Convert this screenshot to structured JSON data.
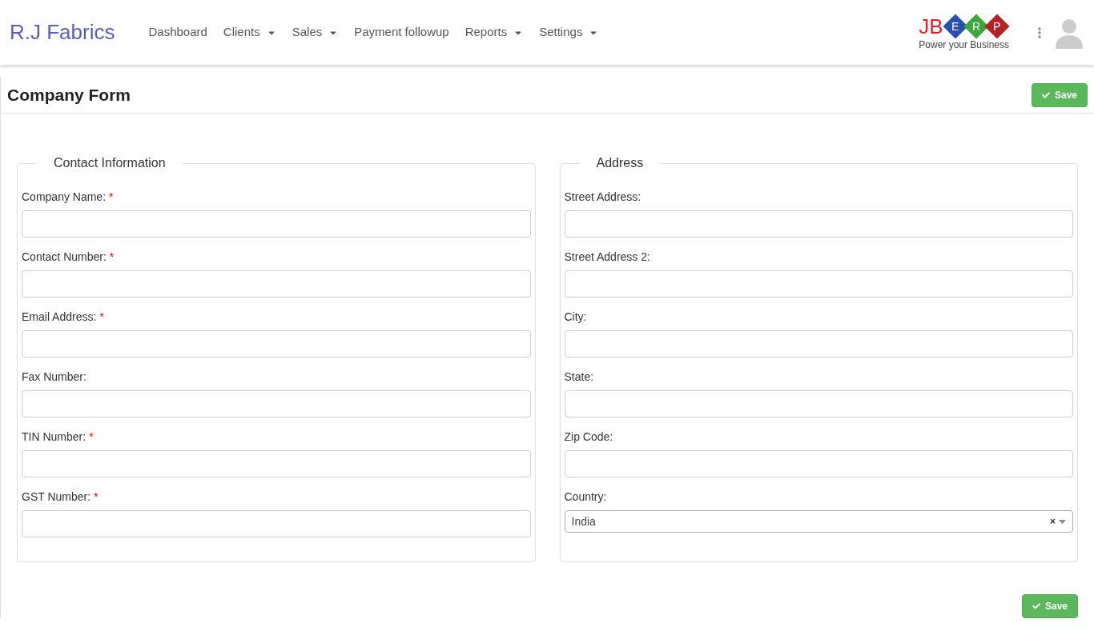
{
  "brand": "R.J Fabrics",
  "nav": [
    {
      "label": "Dashboard",
      "dropdown": false
    },
    {
      "label": "Clients",
      "dropdown": true
    },
    {
      "label": "Sales",
      "dropdown": true
    },
    {
      "label": "Payment followup",
      "dropdown": false
    },
    {
      "label": "Reports",
      "dropdown": true
    },
    {
      "label": "Settings",
      "dropdown": true
    }
  ],
  "logo": {
    "prefix": "JB",
    "tiles": [
      {
        "letter": "E",
        "color": "#2a4fb0"
      },
      {
        "letter": "R",
        "color": "#3aa83a"
      },
      {
        "letter": "P",
        "color": "#b52222"
      }
    ],
    "tagline": "Power your Business"
  },
  "page_title": "Company Form",
  "save_top": "Save",
  "sections": [
    {
      "legend": "Contact Information",
      "fields": [
        {
          "label": "Company Name:",
          "required_mark": "*",
          "kind": "text"
        },
        {
          "label": "Contact Number:",
          "required_mark": "*",
          "kind": "text"
        },
        {
          "label": "Email Address:",
          "required_mark": "*",
          "kind": "text"
        },
        {
          "label": "Fax Number:",
          "kind": "text"
        },
        {
          "label": "TIN Number:",
          "required_mark": "*",
          "kind": "text"
        },
        {
          "label": "GST Number:",
          "required_mark": "*",
          "kind": "text"
        }
      ]
    },
    {
      "legend": "Address",
      "fields": [
        {
          "label": "Street Address:",
          "kind": "text"
        },
        {
          "label": "Street Address 2:",
          "kind": "text"
        },
        {
          "label": "City:",
          "kind": "text"
        },
        {
          "label": "State:",
          "kind": "text"
        },
        {
          "label": "Zip Code:",
          "kind": "text"
        },
        {
          "label": "Country:",
          "kind": "select",
          "value": "India",
          "clear": "×"
        }
      ]
    }
  ],
  "save_bottom": "Save"
}
